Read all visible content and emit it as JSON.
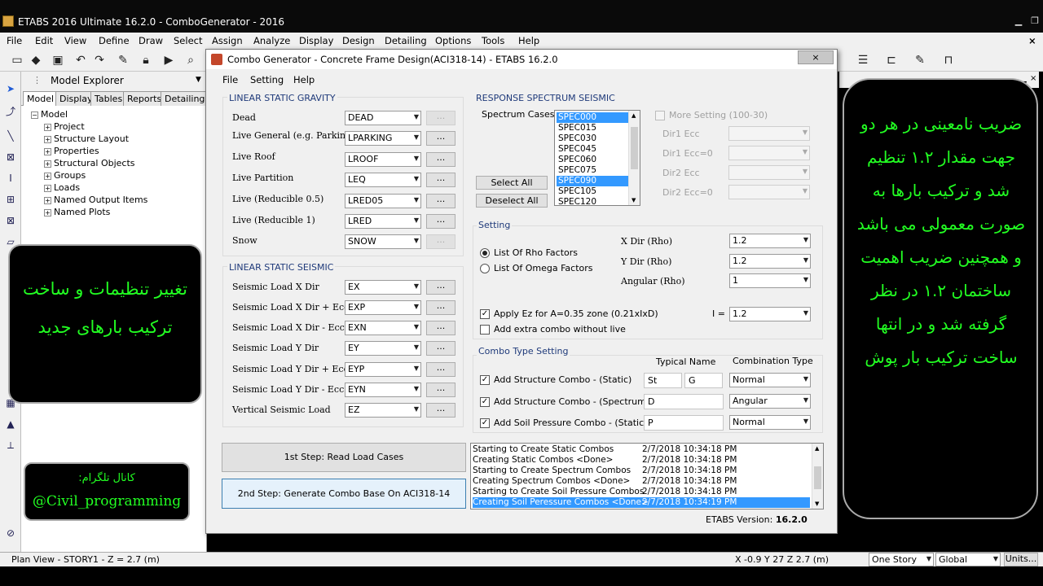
{
  "window": {
    "title": "ETABS 2016 Ultimate 16.2.0 - ComboGenerator - 2016"
  },
  "menu": [
    "File",
    "Edit",
    "View",
    "Define",
    "Draw",
    "Select",
    "Assign",
    "Analyze",
    "Display",
    "Design",
    "Detailing",
    "Options",
    "Tools",
    "Help"
  ],
  "explorer": {
    "title": "Model Explorer",
    "tabs": [
      "Model",
      "Display",
      "Tables",
      "Reports",
      "Detailing"
    ],
    "root": "Model",
    "items": [
      "Project",
      "Structure Layout",
      "Properties",
      "Structural Objects",
      "Groups",
      "Loads",
      "Named Output Items",
      "Named Plots"
    ]
  },
  "dialog": {
    "title": "Combo Generator - Concrete Frame Design(ACI318-14) - ETABS 16.2.0",
    "menu": [
      "File",
      "Setting",
      "Help"
    ],
    "gravity": {
      "heading": "LINEAR STATIC GRAVITY",
      "rows": [
        {
          "label": "Dead",
          "value": "DEAD"
        },
        {
          "label": "Live General (e.g. Parking)",
          "value": "LPARKING"
        },
        {
          "label": "Live Roof",
          "value": "LROOF"
        },
        {
          "label": "Live Partition",
          "value": "LEQ"
        },
        {
          "label": "Live (Reducible 0.5)",
          "value": "LRED05"
        },
        {
          "label": "Live (Reducible 1)",
          "value": "LRED"
        },
        {
          "label": "Snow",
          "value": "SNOW"
        }
      ]
    },
    "seismic": {
      "heading": "LINEAR STATIC SEISMIC",
      "rows": [
        {
          "label": "Seismic Load X Dir",
          "value": "EX"
        },
        {
          "label": "Seismic Load X Dir + Ecc",
          "value": "EXP"
        },
        {
          "label": "Seismic Load X Dir - Ecc",
          "value": "EXN"
        },
        {
          "label": "Seismic Load Y Dir",
          "value": "EY"
        },
        {
          "label": "Seismic Load Y Dir + Ecc",
          "value": "EYP"
        },
        {
          "label": "Seismic Load Y Dir - Ecc",
          "value": "EYN"
        },
        {
          "label": "Vertical Seismic Load",
          "value": "EZ"
        }
      ]
    },
    "dots": "...",
    "step1": "1st Step: Read Load Cases",
    "step2": "2nd Step: Generate Combo Base On ACI318-14",
    "spectrum": {
      "heading": "RESPONSE SPECTRUM SEISMIC",
      "label": "Spectrum Cases",
      "items": [
        "SPEC000",
        "SPEC015",
        "SPEC030",
        "SPEC045",
        "SPEC060",
        "SPEC075",
        "SPEC090",
        "SPEC105",
        "SPEC120"
      ],
      "select_all": "Select All",
      "deselect_all": "Deselect All",
      "more": "More Setting (100-30)",
      "dirs": [
        "Dir1 Ecc",
        "Dir1 Ecc=0",
        "Dir2 Ecc",
        "Dir2 Ecc=0"
      ]
    },
    "setting": {
      "heading": "Setting",
      "radio1": "List Of Rho Factors",
      "radio2": "List Of Omega Factors",
      "xrho_label": "X Dir (Rho)",
      "xrho": "1.2",
      "yrho_label": "Y Dir (Rho)",
      "yrho": "1.2",
      "arho_label": "Angular (Rho)",
      "arho": "1",
      "ez_label": "Apply Ez for A=0.35 zone (0.21xIxD)",
      "i_label": "I =",
      "i_value": "1.2",
      "extra_label": "Add extra combo without live"
    },
    "combo_type": {
      "heading": "Combo Type Setting",
      "col_name": "Typical Name",
      "col_type": "Combination Type",
      "rows": [
        {
          "label": "Add Structure Combo - (Static)",
          "name1": "St",
          "name2": "G",
          "type": "Normal"
        },
        {
          "label": "Add Structure Combo - (Spectrum)",
          "name1": "D",
          "name2": "",
          "type": "Angular"
        },
        {
          "label": "Add Soil Pressure Combo - (Static)",
          "name1": "P",
          "name2": "",
          "type": "Normal"
        }
      ]
    },
    "log": [
      {
        "msg": "Starting to Create Static Combos",
        "time": "2/7/2018 10:34:18 PM"
      },
      {
        "msg": "Creating Static Combos <Done>",
        "time": "2/7/2018 10:34:18 PM"
      },
      {
        "msg": "Starting to Create Spectrum Combos",
        "time": "2/7/2018 10:34:18 PM"
      },
      {
        "msg": "Creating Spectrum Combos <Done>",
        "time": "2/7/2018 10:34:18 PM"
      },
      {
        "msg": "Starting to Create Soil Pressure Combos",
        "time": "2/7/2018 10:34:18 PM"
      },
      {
        "msg": "Creating Soil Peressure Combos <Done>",
        "time": "2/7/2018 10:34:19 PM"
      }
    ],
    "version_label": "ETABS Version:",
    "version_value": "16.2.0"
  },
  "status": {
    "left": "Plan View - STORY1 - Z = 2.7 (m)",
    "coords": "X -0.9  Y 27  Z 2.7 (m)",
    "story": "One Story",
    "coord_sys": "Global",
    "units": "Units..."
  },
  "overlay": {
    "left_text": "تغییر تنظیمات و ساخت ترکیب بارهای جدید",
    "channel_label": "کانال تلگرام:",
    "channel_handle": "@Civil_programming",
    "right_text": "ضریب نامعینی در هر دو جهت مقدار ۱.۲ تنظیم شد و ترکیب بارها به صورت معمولی می باشد و همچنین ضریب اهمیت ساختمان ۱.۲ در نظر گرفته شد و در انتها ساخت ترکیب بار پوش"
  }
}
